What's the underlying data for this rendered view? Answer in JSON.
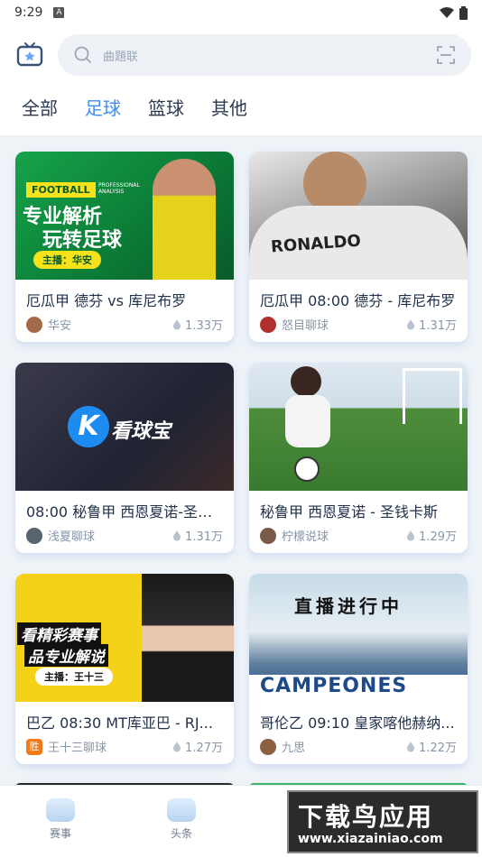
{
  "statusbar": {
    "time": "9:29"
  },
  "search": {
    "placeholder": "曲題联"
  },
  "tabs": [
    {
      "label": "全部",
      "active": false
    },
    {
      "label": "足球",
      "active": true
    },
    {
      "label": "篮球",
      "active": false
    },
    {
      "label": "其他",
      "active": false
    }
  ],
  "cards": [
    {
      "title": "厄瓜甲  德芬 vs 库尼布罗",
      "author": "华安",
      "views": "1.33万",
      "thumb_text": {
        "brand": "FOOTBALL",
        "sub": "PROFESSIONAL ANALYSIS",
        "headline1": "专业解析",
        "headline2": "玩转足球",
        "host": "主播：华安"
      }
    },
    {
      "title": "厄瓜甲 08:00 德芬 - 库尼布罗",
      "author": "怒目聊球",
      "views": "1.31万",
      "thumb_text": {
        "jersey": "RONALDO"
      }
    },
    {
      "title": "08:00 秘鲁甲 西恩夏诺-圣钱...",
      "author": "浅夏聊球",
      "views": "1.31万",
      "thumb_text": {
        "brand": "看球宝"
      }
    },
    {
      "title": "秘鲁甲  西恩夏诺 - 圣钱卡斯",
      "author": "柠檬说球",
      "views": "1.29万",
      "thumb_text": {}
    },
    {
      "title": "巴乙 08:30 MT库亚巴 - RJ...",
      "author": "王十三聊球",
      "views": "1.27万",
      "thumb_text": {
        "headline1": "看精彩赛事",
        "headline2": "品专业解说",
        "host": "主播：王十三"
      }
    },
    {
      "title": "哥伦乙 09:10 皇家喀他赫纳...",
      "author": "九思",
      "views": "1.22万",
      "thumb_text": {
        "headline1": "直播进行中",
        "banner": "CAMPEONES"
      }
    }
  ],
  "bottom_nav": [
    {
      "label": "赛事"
    },
    {
      "label": "头条"
    }
  ],
  "watermark": {
    "line1": "下载鸟应用",
    "line2": "www.xiazainiao.com"
  },
  "colors": {
    "accent": "#3d8df5",
    "card_title": "#22324a",
    "meta": "#8796a8"
  }
}
